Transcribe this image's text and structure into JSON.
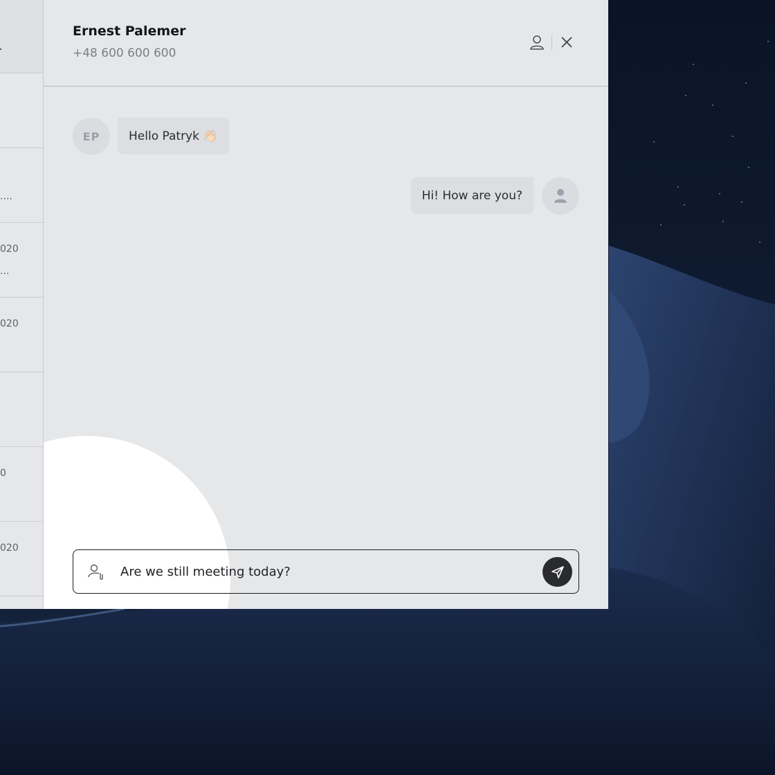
{
  "conversation_list": {
    "rows": [
      {
        "date": "",
        "preview": ""
      },
      {
        "date": "",
        "preview": "...."
      },
      {
        "date": "020",
        "preview": "..."
      },
      {
        "date": "020",
        "preview": ""
      },
      {
        "date": "",
        "preview": ""
      },
      {
        "date": "0",
        "preview": ""
      },
      {
        "date": "020",
        "preview": ""
      }
    ]
  },
  "chat": {
    "contact_name": "Ernest Palemer",
    "contact_phone": "+48 600 600 600",
    "messages": [
      {
        "direction": "incoming",
        "avatar_initials": "EP",
        "text": "Hello Patryk 👋🏻"
      },
      {
        "direction": "outgoing",
        "text": "Hi! How are you?"
      }
    ],
    "composer": {
      "value": "Are we still meeting today?",
      "placeholder": ""
    }
  },
  "icons": {
    "profile": "user-icon",
    "close": "close-icon",
    "attach": "user-attach-icon",
    "send": "send-icon"
  },
  "colors": {
    "panel_bg": "#e6e7e9",
    "bubble_bg": "#dcdee2",
    "send_button": "#2a2b2e",
    "wallpaper": "#0f1a30"
  }
}
